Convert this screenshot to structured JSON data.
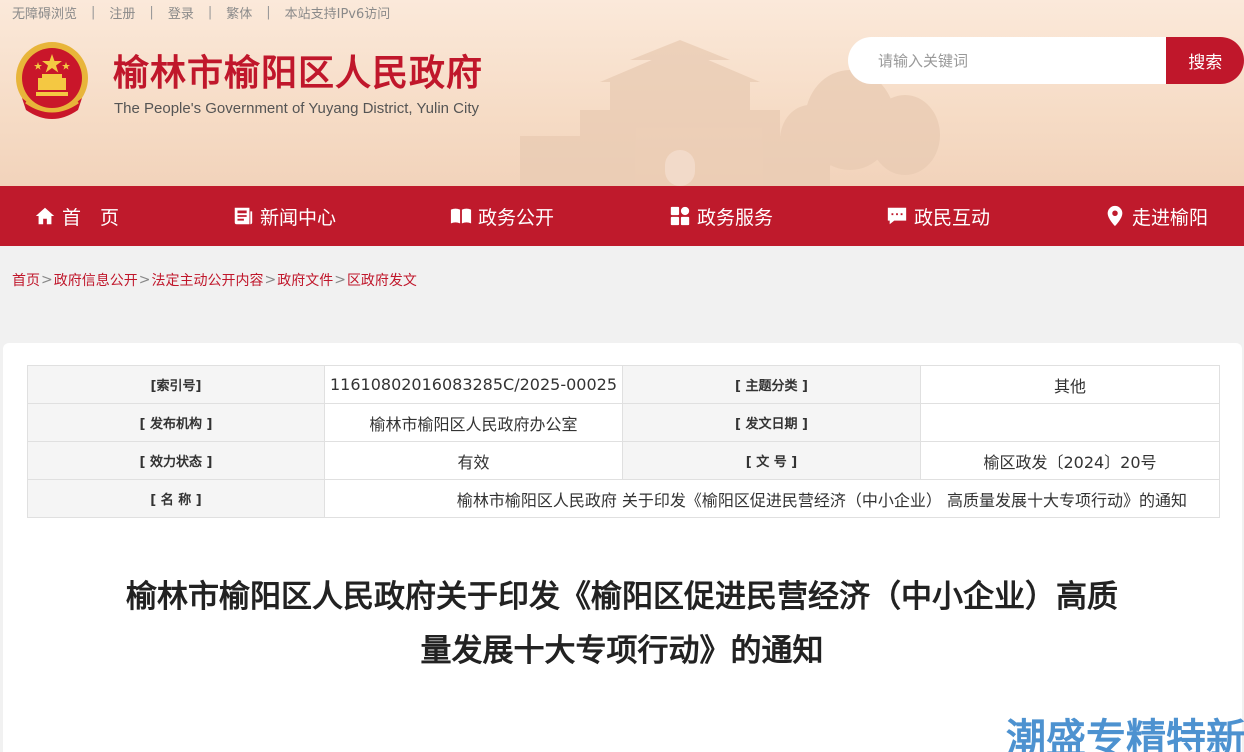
{
  "topbar": {
    "links": [
      "无障碍浏览",
      "注册",
      "登录",
      "繁体",
      "本站支持IPv6访问"
    ]
  },
  "site": {
    "title": "榆林市榆阳区人民政府",
    "subtitle": "The People's Government of Yuyang District, Yulin City"
  },
  "search": {
    "placeholder": "请输入关键词",
    "button_label": "搜索"
  },
  "nav": {
    "items": [
      {
        "label": "首　页",
        "icon": "home-icon"
      },
      {
        "label": "新闻中心",
        "icon": "news-icon"
      },
      {
        "label": "政务公开",
        "icon": "book-icon"
      },
      {
        "label": "政务服务",
        "icon": "grid-icon"
      },
      {
        "label": "政民互动",
        "icon": "chat-icon"
      },
      {
        "label": "走进榆阳",
        "icon": "location-icon"
      }
    ]
  },
  "breadcrumb": [
    "首页",
    "政府信息公开",
    "法定主动公开内容",
    "政府文件",
    "区政府发文"
  ],
  "meta": {
    "index_label": "[索引号]",
    "index_value": "11610802016083285C/2025-00025",
    "category_label": "[ 主题分类 ]",
    "category_value": "其他",
    "publisher_label": "[ 发布机构 ]",
    "publisher_value": "榆林市榆阳区人民政府办公室",
    "date_label": "[ 发文日期 ]",
    "date_value": "",
    "status_label": "[ 效力状态 ]",
    "status_value": "有效",
    "docno_label": "[ 文 号 ]",
    "docno_value": "榆区政发〔2024〕20号",
    "name_label": "[ 名 称 ]",
    "name_value": "榆林市榆阳区人民政府 关于印发《榆阳区促进民营经济（中小企业） 高质量发展十大专项行动》的通知"
  },
  "document": {
    "title_line1": "榆林市榆阳区人民政府关于印发《榆阳区促进民营经济（中小企业）高质",
    "title_line2": "量发展十大专项行动》的通知"
  },
  "watermark": "潮盛专精特新",
  "colors": {
    "brand_red": "#bf1a2c",
    "header_bg": "#f6dcc6",
    "watermark_blue": "#2f7fc8"
  }
}
